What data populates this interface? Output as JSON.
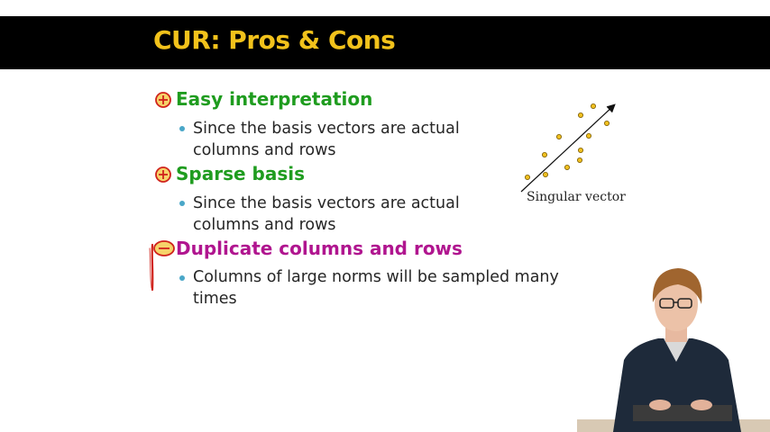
{
  "slide": {
    "title": "CUR: Pros & Cons",
    "sections": [
      {
        "heading": "Easy interpretation",
        "kind": "pro",
        "bullet_lines": [
          "Since the basis vectors are actual",
          "columns and rows"
        ]
      },
      {
        "heading": "Sparse basis",
        "kind": "pro",
        "bullet_lines": [
          "Since the basis vectors are actual",
          "columns and rows"
        ]
      },
      {
        "heading": "Duplicate columns and rows",
        "kind": "con",
        "bullet_lines": [
          "Columns of large norms will be sampled many",
          "times"
        ]
      }
    ],
    "figure": {
      "caption": "Singular vector"
    }
  },
  "colors": {
    "title_bar": "#000000",
    "title_text": "#f2c21b",
    "pro_heading": "#1f9c1f",
    "con_heading": "#b0158f",
    "bullet": "#4aa7c8",
    "icon_mark": "#d0231c",
    "points": "#f0c020"
  },
  "icons": [
    "plus-circle-icon",
    "plus-circle-icon",
    "minus-circle-icon"
  ]
}
